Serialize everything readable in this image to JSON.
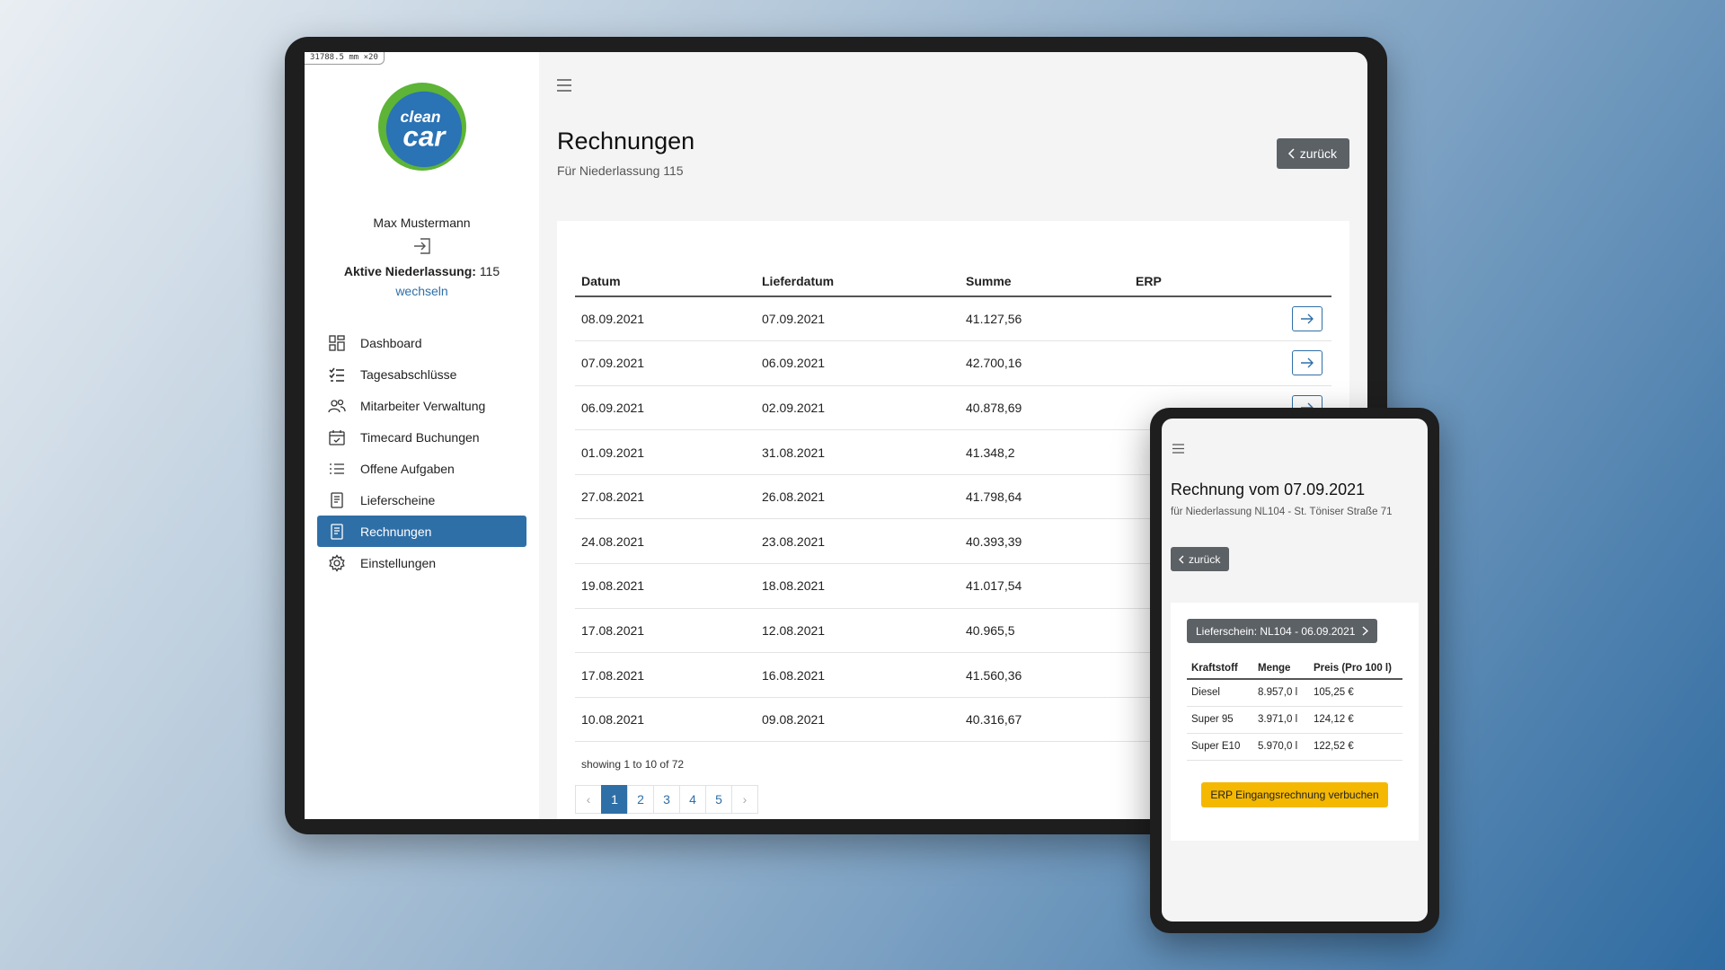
{
  "readout": "31788.5 mm ×20",
  "logo": {
    "line1": "clean",
    "line2": "car"
  },
  "sidebar": {
    "user_name": "Max Mustermann",
    "active_branch_label": "Aktive Niederlassung:",
    "active_branch_value": "115",
    "switch_link": "wechseln",
    "items": [
      {
        "label": "Dashboard",
        "icon": "dashboard-icon"
      },
      {
        "label": "Tagesabschlüsse",
        "icon": "checklist-icon"
      },
      {
        "label": "Mitarbeiter Verwaltung",
        "icon": "users-icon"
      },
      {
        "label": "Timecard Buchungen",
        "icon": "calendar-check-icon"
      },
      {
        "label": "Offene Aufgaben",
        "icon": "list-icon"
      },
      {
        "label": "Lieferscheine",
        "icon": "document-icon"
      },
      {
        "label": "Rechnungen",
        "icon": "document-icon",
        "active": true
      },
      {
        "label": "Einstellungen",
        "icon": "gear-icon"
      }
    ]
  },
  "main": {
    "title": "Rechnungen",
    "subtitle": "Für Niederlassung 115",
    "back_label": "zurück",
    "table": {
      "headers": [
        "Datum",
        "Lieferdatum",
        "Summe",
        "ERP"
      ],
      "rows": [
        [
          "08.09.2021",
          "07.09.2021",
          "41.127,56"
        ],
        [
          "07.09.2021",
          "06.09.2021",
          "42.700,16"
        ],
        [
          "06.09.2021",
          "02.09.2021",
          "40.878,69"
        ],
        [
          "01.09.2021",
          "31.08.2021",
          "41.348,2"
        ],
        [
          "27.08.2021",
          "26.08.2021",
          "41.798,64"
        ],
        [
          "24.08.2021",
          "23.08.2021",
          "40.393,39"
        ],
        [
          "19.08.2021",
          "18.08.2021",
          "41.017,54"
        ],
        [
          "17.08.2021",
          "12.08.2021",
          "40.965,5"
        ],
        [
          "17.08.2021",
          "16.08.2021",
          "41.560,36"
        ],
        [
          "10.08.2021",
          "09.08.2021",
          "40.316,67"
        ]
      ]
    },
    "showing": "showing 1 to 10 of 72",
    "pagination": {
      "prev": "‹",
      "pages": [
        "1",
        "2",
        "3",
        "4",
        "5"
      ],
      "next": "›",
      "active": "1"
    }
  },
  "phone": {
    "title": "Rechnung vom 07.09.2021",
    "subtitle": "für Niederlassung NL104 - St. Töniser Straße 71",
    "back_label": "zurück",
    "delivery_button": "Lieferschein: NL104 - 06.09.2021",
    "table": {
      "headers": [
        "Kraftstoff",
        "Menge",
        "Preis (Pro 100 l)"
      ],
      "rows": [
        [
          "Diesel",
          "8.957,0 l",
          "105,25 €"
        ],
        [
          "Super 95",
          "3.971,0 l",
          "124,12 €"
        ],
        [
          "Super E10",
          "5.970,0 l",
          "122,52 €"
        ]
      ]
    },
    "erp_button": "ERP Eingangsrechnung verbuchen"
  },
  "colors": {
    "primary": "#2f6fa7",
    "secondary": "#5c6166",
    "warning": "#f5b800",
    "logo_green": "#5db436",
    "logo_blue": "#2a73b5"
  }
}
